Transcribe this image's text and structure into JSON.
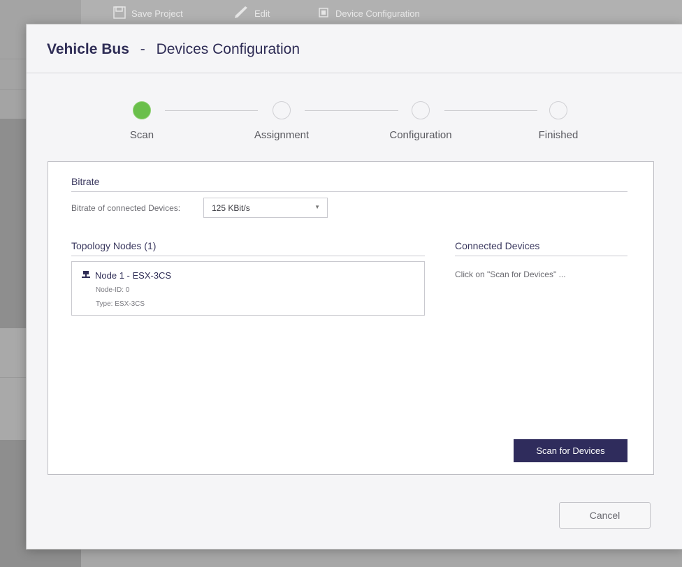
{
  "toolbar": {
    "items": [
      {
        "label": "Save Project",
        "icon": "save-icon"
      },
      {
        "label": "Edit",
        "icon": "pencil-icon"
      },
      {
        "label": "Device Configuration",
        "icon": "chip-icon"
      }
    ]
  },
  "modal": {
    "title_strong": "Vehicle Bus",
    "title_separator": "-",
    "title_rest": "Devices Configuration"
  },
  "stepper": {
    "steps": [
      {
        "label": "Scan",
        "state": "active"
      },
      {
        "label": "Assignment",
        "state": "pending"
      },
      {
        "label": "Configuration",
        "state": "pending"
      },
      {
        "label": "Finished",
        "state": "pending"
      }
    ],
    "active_color": "#6abf4b"
  },
  "bitrate": {
    "section_title": "Bitrate",
    "label": "Bitrate of connected Devices:",
    "selected": "125 KBit/s"
  },
  "topology": {
    "section_title": "Topology Nodes (1)",
    "nodes": [
      {
        "title": "Node 1 - ESX-3CS",
        "node_id": "Node-ID: 0",
        "type": "Type: ESX-3CS",
        "icon": "network-node-icon"
      }
    ]
  },
  "connected": {
    "section_title": "Connected Devices",
    "hint": "Click on \"Scan for Devices\" ..."
  },
  "buttons": {
    "scan": "Scan for Devices",
    "cancel": "Cancel"
  },
  "colors": {
    "primary": "#2f2c5c",
    "title": "#2e2c55"
  }
}
